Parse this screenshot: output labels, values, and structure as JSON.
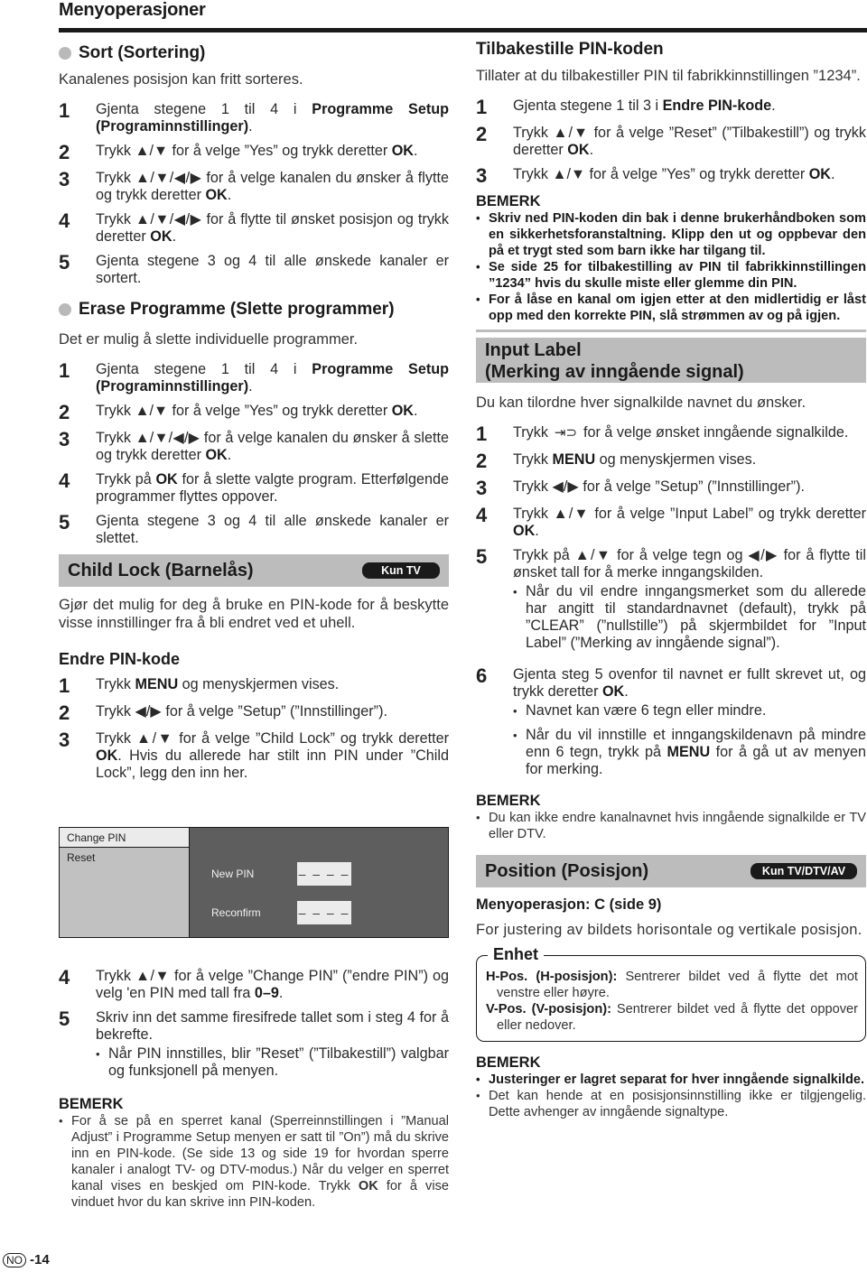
{
  "page": {
    "title": "Menyoperasjoner",
    "footer_region": "NO",
    "footer_page": "-14"
  },
  "sort": {
    "heading": "Sort (Sortering)",
    "intro": "Kanalenes posisjon kan fritt sorteres.",
    "steps": [
      {
        "num": "1",
        "html": "Gjenta stegene 1 til 4 i <b>Programme Setup (Programinnstillinger)</b>."
      },
      {
        "num": "2",
        "html": "Trykk ▲/▼ for å velge ”Yes” og trykk deretter <b>OK</b>."
      },
      {
        "num": "3",
        "html": "Trykk ▲/▼/◀/▶ for å velge kanalen du ønsker å flytte og trykk deretter <b>OK</b>."
      },
      {
        "num": "4",
        "html": "Trykk ▲/▼/◀/▶ for å flytte til ønsket posisjon og trykk deretter  <b>OK</b>."
      },
      {
        "num": "5",
        "html": "Gjenta stegene 3 og 4 til alle ønskede kanaler er sortert."
      }
    ]
  },
  "erase": {
    "heading": "Erase Programme (Slette programmer)",
    "intro": "Det er mulig å slette individuelle programmer.",
    "steps": [
      {
        "num": "1",
        "html": "Gjenta stegene 1 til 4 i <b>Programme Setup (Programinnstillinger)</b>."
      },
      {
        "num": "2",
        "html": "Trykk ▲/▼ for å velge ”Yes” og trykk deretter  <b>OK</b>."
      },
      {
        "num": "3",
        "html": "Trykk ▲/▼/◀/▶ for å velge kanalen du ønsker å slette og trykk deretter <b>OK</b>."
      },
      {
        "num": "4",
        "html": "Trykk på <b>OK</b> for å slette valgte program. Etterfølgende programmer flyttes oppover."
      },
      {
        "num": "5",
        "html": "Gjenta stegene 3 og 4 til alle ønskede kanaler er slettet."
      }
    ]
  },
  "child_lock": {
    "title": "Child Lock (Barnelås)",
    "badge": "Kun TV",
    "intro": "Gjør det mulig for deg å bruke en PIN-kode for å beskytte visse innstillinger fra å bli endret ved et uhell.",
    "endre_heading": "Endre PIN-kode",
    "steps_a": [
      {
        "num": "1",
        "html": "Trykk <b>MENU</b> og menyskjermen vises."
      },
      {
        "num": "2",
        "html": "Trykk ◀/▶ for å velge ”Setup” (”Innstillinger”)."
      },
      {
        "num": "3",
        "html": "Trykk ▲/▼ for å velge ”Child Lock” og trykk deretter <b>OK</b>. Hvis du allerede har stilt inn PIN under ”Child Lock”, legg den inn her."
      }
    ],
    "menu": {
      "items": [
        "Change PIN",
        "Reset"
      ],
      "selected": "Change PIN",
      "new_pin_label": "New PIN",
      "new_pin_value": "– – – –",
      "reconfirm_label": "Reconfirm",
      "reconfirm_value": "– – – –"
    },
    "steps_b": [
      {
        "num": "4",
        "html": "Trykk ▲/▼ for å velge ”Change PIN” (”endre PIN”) og velg 'en PIN med tall fra <b>0–9</b>."
      },
      {
        "num": "5",
        "html": "Skriv inn det samme firesifrede tallet som i steg 4 for å bekrefte.",
        "bullets": [
          "Når PIN innstilles, blir ”Reset” (”Tilbakestill”) valgbar og funksjonell på menyen."
        ]
      }
    ],
    "note_title": "BEMERK",
    "notes": [
      "For å se på en sperret kanal (Sperreinnstillingen i ”Manual Adjust” i Programme Setup menyen er satt til ”On”) må du skrive inn en PIN-kode. (Se side 13 og side 19 for hvordan sperre kanaler i analogt TV- og DTV-modus.) Når du velger en sperret kanal vises en beskjed om PIN-kode. Trykk <b>OK</b> for å vise vinduet hvor du kan skrive inn PIN-koden."
    ]
  },
  "reset_pin": {
    "heading": "Tilbakestille PIN-koden",
    "intro": "Tillater at du tilbakestiller PIN til fabrikkinnstillingen ”1234”.",
    "steps": [
      {
        "num": "1",
        "html": "Gjenta stegene 1 til 3 i <b>Endre PIN-kode</b>."
      },
      {
        "num": "2",
        "html": "Trykk ▲/▼ for å velge ”Reset” (”Tilbakestill”) og trykk deretter <b>OK</b>."
      },
      {
        "num": "3",
        "html": "Trykk ▲/▼ for å velge ”Yes” og trykk deretter <b>OK</b>."
      }
    ],
    "note_title": "BEMERK",
    "notes": [
      "Skriv ned PIN-koden din bak i denne brukerhåndboken som en sikkerhetsforanstaltning. Klipp den ut og oppbevar den på et trygt sted som barn ikke har tilgang til.",
      "Se side 25 for tilbakestilling av PIN til fabrikkinnstillingen ”1234” hvis du skulle miste eller glemme din PIN.",
      "For å låse en kanal om igjen etter at den midlertidig er låst opp med den korrekte PIN, slå strømmen av og på igjen."
    ]
  },
  "input_label": {
    "title_line1": "Input Label",
    "title_line2": "(Merking av inngående signal)",
    "intro": "Du kan tilordne hver signalkilde navnet du ønsker.",
    "input_icon": "input-source-icon",
    "steps": [
      {
        "num": "1",
        "html": "Trykk <span class=\"input-icon\" data-name=\"input-source-icon\">⇥⊃</span> for å velge ønsket inngående signalkilde."
      },
      {
        "num": "2",
        "html": "Trykk <b>MENU</b> og menyskjermen vises."
      },
      {
        "num": "3",
        "html": "Trykk ◀/▶ for å velge ”Setup” (”Innstillinger”)."
      },
      {
        "num": "4",
        "html": "Trykk ▲/▼ for å velge ”Input Label” og trykk deretter <b>OK</b>."
      },
      {
        "num": "5",
        "html": "Trykk på ▲/▼ for å velge tegn og ◀/▶ for å flytte til ønsket tall for å merke inngangskilden.",
        "bullets": [
          "Når du vil endre inngangsmerket som du allerede har angitt til standardnavnet (default), trykk på ”CLEAR” (”nullstille”) på skjermbildet for ”Input Label” (”Merking av inngående signal”)."
        ]
      },
      {
        "num": "6",
        "html": "Gjenta steg 5 ovenfor til navnet er fullt skrevet ut, og trykk deretter <b>OK</b>.",
        "bullets": [
          "Navnet kan være 6 tegn eller mindre.",
          "Når du vil innstille et inngangskildenavn på mindre enn 6 tegn, trykk på <b>MENU</b> for å gå ut av menyen for merking."
        ]
      }
    ],
    "note_title": "BEMERK",
    "notes": [
      "Du kan ikke endre kanalnavnet hvis inngående signalkilde er TV eller DTV."
    ]
  },
  "position": {
    "title": "Position (Posisjon)",
    "badge": "Kun TV/DTV/AV",
    "sub_heading": "Menyoperasjon: C (side 9)",
    "intro": "For justering av bildets horisontale og vertikale posisjon.",
    "enhet_label": "Enhet",
    "enhet_rows": [
      {
        "term": "H-Pos. (H-posisjon):",
        "desc": " Sentrerer bildet ved å flytte det mot venstre eller høyre."
      },
      {
        "term": "V-Pos. (V-posisjon):",
        "desc": " Sentrerer bildet ved å flytte det oppover eller nedover."
      }
    ],
    "note_title": "BEMERK",
    "notes_bold": [
      "Justeringer er lagret separat for hver inngående signalkilde."
    ],
    "notes": [
      "Det kan hende at en posisjonsinnstilling ikke er tilgjengelig. Dette avhenger av inngående signaltype."
    ]
  }
}
